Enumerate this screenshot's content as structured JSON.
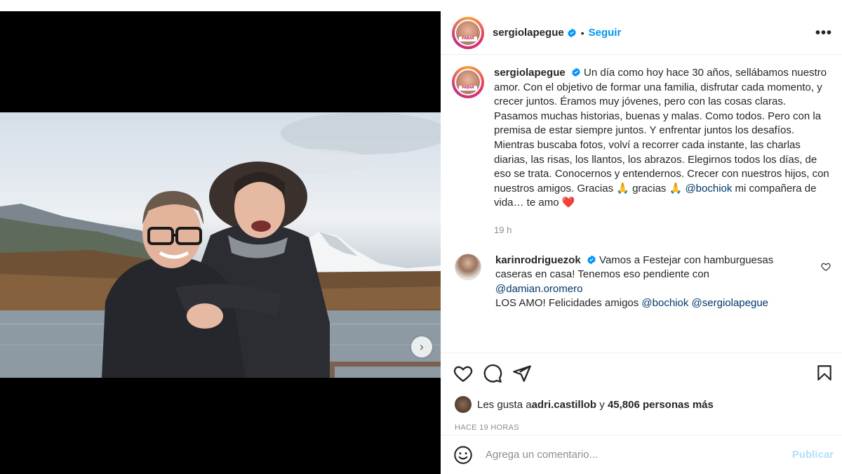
{
  "post": {
    "username": "sergiolapegue",
    "follow_label": "Seguir",
    "more_label": "•••",
    "avatar_tag": "PABAR"
  },
  "caption": {
    "username": "sergiolapegue",
    "text_1": "Un día como hoy hace 30 años, sellábamos nuestro amor. Con el objetivo de formar una familia, disfrutar cada momento, y crecer juntos. Éramos muy jóvenes, pero con las cosas claras. Pasamos muchas historias, buenas y malas. Como todos. Pero con la premisa de estar siempre juntos. Y enfrentar juntos los desafíos. Mientras buscaba fotos, volví a recorrer cada instante, las charlas diarias, las risas, los llantos, los abrazos. Elegirnos todos los días, de eso se trata. Conocernos y entendernos. Crecer con nuestros hijos, con nuestros amigos. Gracias 🙏 gracias 🙏",
    "mention": "@bochiok",
    "text_2": " mi compañera de vida… te amo ❤️",
    "time": "19 h"
  },
  "comment": {
    "username": "karinrodriguezok",
    "text_1": "Vamos a Festejar con hamburguesas caseras en casa! Tenemos eso pendiente con",
    "mention_1": "@damian.oromero",
    "text_2": "LOS AMO! Felicidades amigos ",
    "mention_2": "@bochiok",
    "mention_3": "@sergiolapegue"
  },
  "likes": {
    "prefix": "Les gusta a ",
    "user": "adri.castillob",
    "middle": " y ",
    "count": "45,806 personas más"
  },
  "timestamp": "HACE 19 HORAS",
  "add_comment": {
    "placeholder": "Agrega un comentario...",
    "publish_label": "Publicar"
  },
  "carousel": {
    "total_dots": 10,
    "active_index": 1,
    "next_icon": "chevron-right-icon"
  },
  "colors": {
    "accent": "#0095f6",
    "mention": "#00376b",
    "muted": "#8e8e8e",
    "publish_disabled": "#b2dffc",
    "heart": "#ed4956"
  }
}
